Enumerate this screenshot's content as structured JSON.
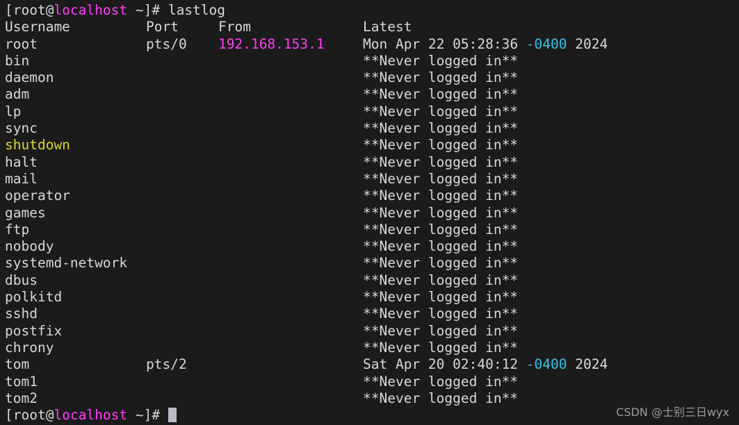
{
  "terminal": {
    "background_color": "#1b1b1b",
    "foreground_color": "#d6d6d6",
    "accent_colors": {
      "host_magenta": "#ff3ff7",
      "ip_magenta": "#ff3ff7",
      "shutdown_yellow": "#d8d82a",
      "timezone_cyan": "#35c5e8",
      "cursor": "#b8bac4"
    },
    "command_line": {
      "bracket_open": "[",
      "user": "root",
      "at": "@",
      "host": "localhost",
      "path": " ~",
      "bracket_close": "]",
      "sigil": "# ",
      "command": "lastlog"
    },
    "headers": {
      "username": "Username",
      "port": "Port",
      "from": "From",
      "latest": "Latest"
    },
    "rows": [
      {
        "username": "root",
        "username_color": "normal",
        "port": "pts/0",
        "from": "192.168.153.1",
        "latest_prefix": "Mon Apr 22 05:28:36 ",
        "latest_tz": "-0400",
        "latest_suffix": " 2024",
        "never": false
      },
      {
        "username": "bin",
        "username_color": "normal",
        "port": "",
        "from": "",
        "latest_never": "**Never logged in**",
        "never": true
      },
      {
        "username": "daemon",
        "username_color": "normal",
        "port": "",
        "from": "",
        "latest_never": "**Never logged in**",
        "never": true
      },
      {
        "username": "adm",
        "username_color": "normal",
        "port": "",
        "from": "",
        "latest_never": "**Never logged in**",
        "never": true
      },
      {
        "username": "lp",
        "username_color": "normal",
        "port": "",
        "from": "",
        "latest_never": "**Never logged in**",
        "never": true
      },
      {
        "username": "sync",
        "username_color": "normal",
        "port": "",
        "from": "",
        "latest_never": "**Never logged in**",
        "never": true
      },
      {
        "username": "shutdown",
        "username_color": "yellow",
        "port": "",
        "from": "",
        "latest_never": "**Never logged in**",
        "never": true
      },
      {
        "username": "halt",
        "username_color": "normal",
        "port": "",
        "from": "",
        "latest_never": "**Never logged in**",
        "never": true
      },
      {
        "username": "mail",
        "username_color": "normal",
        "port": "",
        "from": "",
        "latest_never": "**Never logged in**",
        "never": true
      },
      {
        "username": "operator",
        "username_color": "normal",
        "port": "",
        "from": "",
        "latest_never": "**Never logged in**",
        "never": true
      },
      {
        "username": "games",
        "username_color": "normal",
        "port": "",
        "from": "",
        "latest_never": "**Never logged in**",
        "never": true
      },
      {
        "username": "ftp",
        "username_color": "normal",
        "port": "",
        "from": "",
        "latest_never": "**Never logged in**",
        "never": true
      },
      {
        "username": "nobody",
        "username_color": "normal",
        "port": "",
        "from": "",
        "latest_never": "**Never logged in**",
        "never": true
      },
      {
        "username": "systemd-network",
        "username_color": "normal",
        "port": "",
        "from": "",
        "latest_never": "**Never logged in**",
        "never": true
      },
      {
        "username": "dbus",
        "username_color": "normal",
        "port": "",
        "from": "",
        "latest_never": "**Never logged in**",
        "never": true
      },
      {
        "username": "polkitd",
        "username_color": "normal",
        "port": "",
        "from": "",
        "latest_never": "**Never logged in**",
        "never": true
      },
      {
        "username": "sshd",
        "username_color": "normal",
        "port": "",
        "from": "",
        "latest_never": "**Never logged in**",
        "never": true
      },
      {
        "username": "postfix",
        "username_color": "normal",
        "port": "",
        "from": "",
        "latest_never": "**Never logged in**",
        "never": true
      },
      {
        "username": "chrony",
        "username_color": "normal",
        "port": "",
        "from": "",
        "latest_never": "**Never logged in**",
        "never": true
      },
      {
        "username": "tom",
        "username_color": "normal",
        "port": "pts/2",
        "from": "",
        "latest_prefix": "Sat Apr 20 02:40:12 ",
        "latest_tz": "-0400",
        "latest_suffix": " 2024",
        "never": false
      },
      {
        "username": "tom1",
        "username_color": "normal",
        "port": "",
        "from": "",
        "latest_never": "**Never logged in**",
        "never": true
      },
      {
        "username": "tom2",
        "username_color": "normal",
        "port": "",
        "from": "",
        "latest_never": "**Never logged in**",
        "never": true
      }
    ],
    "final_prompt": {
      "bracket_open": "[",
      "user": "root",
      "at": "@",
      "host": "localhost",
      "path": " ~",
      "bracket_close": "]",
      "sigil": "# "
    }
  },
  "watermark": {
    "text": "CSDN @士别三日wyx"
  }
}
